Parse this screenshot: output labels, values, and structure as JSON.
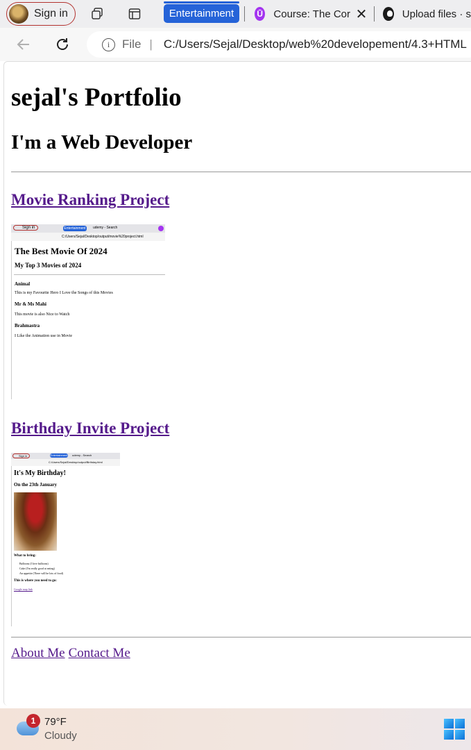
{
  "browser": {
    "signin_label": "Sign in",
    "group_label": "Entertainment",
    "tabs": [
      {
        "title": "Course: The Cor",
        "icon": "udemy-icon"
      },
      {
        "title": "Upload files · s",
        "icon": "github-icon"
      }
    ],
    "address": {
      "scheme_label": "File",
      "url": "C:/Users/Sejal/Desktop/web%20developement/4.3+HTML"
    }
  },
  "page": {
    "title": "sejal's Portfolio",
    "subtitle": "I'm a Web Developer",
    "projects": [
      {
        "link_text": "Movie Ranking Project",
        "preview": {
          "tab_label": "Sign in",
          "group": "Entertainment",
          "tab_title": "udemy - Search",
          "url": "C:/Users/Sejal/Desktop/output/movie%20project.html",
          "h1": "The Best Movie Of 2024",
          "h2": "My Top 3 Movies of 2024",
          "items": [
            {
              "name": "Animal",
              "desc": "This is my Favourite Hero I Love the Songs of this Movies"
            },
            {
              "name": "Mr & Ms Mahi",
              "desc": "This movie is also Nice to Watch"
            },
            {
              "name": "Brahmastra",
              "desc": "I Like the Animation use in Movie"
            }
          ]
        }
      },
      {
        "link_text": "Birthday Invite Project",
        "preview": {
          "tab_label": "Sign in",
          "group": "Entertainment",
          "tab_title": "udemy - Search",
          "url": "C:/Users/Sejal/Desktop/output/Birthday.html",
          "h1": "It's My Birthday!",
          "h2": "On the 23th January",
          "what_label": "What to bring:",
          "bring": [
            "Balloons (I love balloons)",
            "Cake (I'm really good at eating)",
            "An appetite (There will be lots of food)"
          ],
          "where_label": "This is where you need to go:",
          "map_link": "Google map link"
        }
      }
    ],
    "footer_links": [
      "About Me",
      "Contact Me"
    ]
  },
  "taskbar": {
    "temperature": "79°F",
    "condition": "Cloudy",
    "badge_count": "1"
  }
}
